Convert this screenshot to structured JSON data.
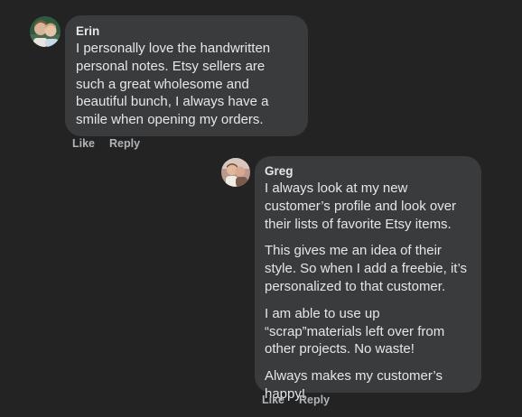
{
  "comments": [
    {
      "author": "Erin",
      "paragraphs": [
        "I personally love the handwritten personal notes. Etsy sellers are such a great wholesome and beautiful bunch, I always have a smile when opening my orders."
      ],
      "actions": {
        "like": "Like",
        "reply": "Reply"
      }
    },
    {
      "author": "Greg",
      "paragraphs": [
        "I always look at my new customer’s profile and look over their lists of favorite Etsy items.",
        "This gives me an idea of their style. So when I add a freebie, it’s personalized to that customer.",
        "I am able to use up “scrap”materials left over from other projects. No waste!",
        "Always makes my customer’s happy!"
      ],
      "actions": {
        "like": "Like",
        "reply": "Reply"
      }
    }
  ],
  "colors": {
    "background": "#232324",
    "bubble": "#3a3b3c",
    "text": "#e4e6eb",
    "action_text": "#b0b3b8"
  }
}
